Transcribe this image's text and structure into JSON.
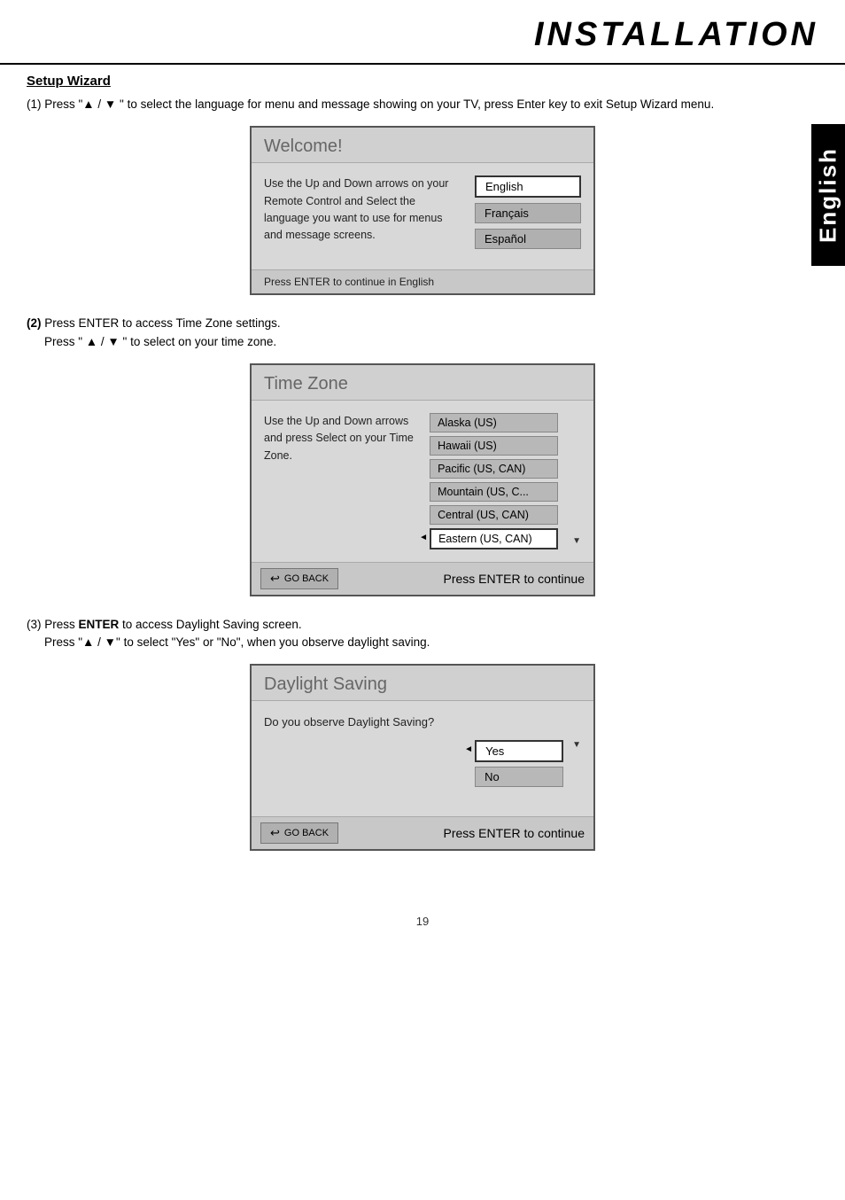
{
  "header": {
    "title": "INSTALLATION"
  },
  "vertical_tab": {
    "label": "English"
  },
  "sections": {
    "setup_wizard": {
      "title": "Setup Wizard",
      "step1_text": "(1) Press \"▲ / ▼ \" to select the language for menu and message showing on your TV, press Enter key to exit Setup Wizard menu.",
      "screen1": {
        "title": "Welcome!",
        "body_text": "Use the Up and Down arrows on your Remote Control and Select the language you want to use for menus and message screens.",
        "options": [
          "English",
          "Français",
          "Español"
        ],
        "selected_option": "English",
        "footer": "Press ENTER to continue in English"
      },
      "step2_text_bold": "(2)",
      "step2_text": " Press ENTER to access Time Zone settings.",
      "step2_sub": "Press \" ▲ / ▼ \" to select on your time zone.",
      "screen2": {
        "title": "Time Zone",
        "body_text": "Use the Up and Down arrows and press Select on your Time Zone.",
        "options": [
          "Alaska (US)",
          "Hawaii (US)",
          "Pacific (US, CAN)",
          "Mountain (US, C...",
          "Central (US, CAN)",
          "Eastern (US, CAN)"
        ],
        "selected_option": "Eastern (US, CAN)",
        "go_back_label": "GO BACK",
        "footer": "Press ENTER to continue"
      },
      "step3_text_prefix": "(3) Press ",
      "step3_text_bold": "ENTER",
      "step3_text_suffix": " to access Daylight Saving screen.",
      "step3_sub": "Press \"▲ / ▼\" to select \"Yes\" or \"No\", when you observe daylight saving.",
      "screen3": {
        "title": "Daylight Saving",
        "body_text": "Do you observe Daylight Saving?",
        "options": [
          "Yes",
          "No"
        ],
        "selected_option": "Yes",
        "go_back_label": "GO BACK",
        "footer": "Press ENTER to continue"
      }
    }
  },
  "page_number": "19"
}
